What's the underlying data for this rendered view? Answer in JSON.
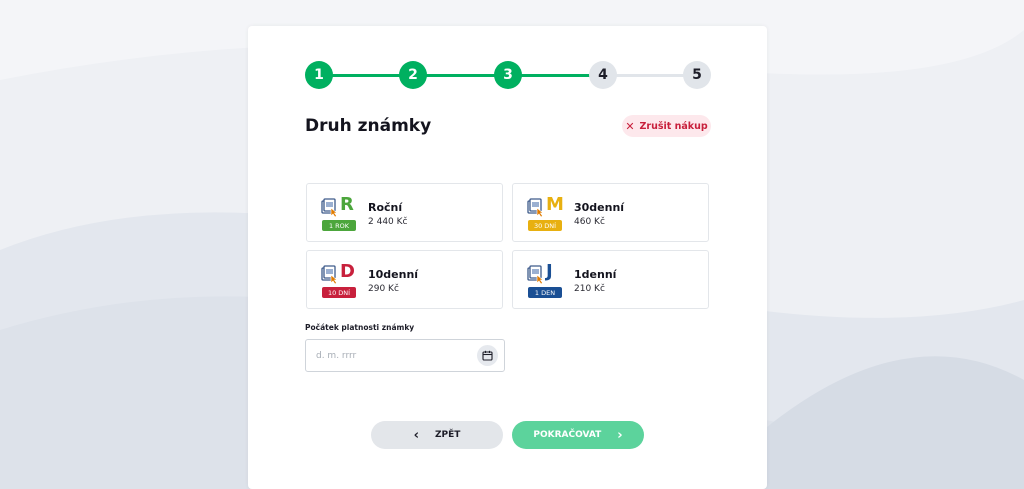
{
  "stepper": {
    "steps": [
      {
        "label": "1",
        "state": "done"
      },
      {
        "label": "2",
        "state": "done"
      },
      {
        "label": "3",
        "state": "done"
      },
      {
        "label": "4",
        "state": "todo"
      },
      {
        "label": "5",
        "state": "todo"
      }
    ],
    "done_color": "#00b060",
    "todo_color": "#e1e5ea"
  },
  "header": {
    "title": "Druh známky",
    "cancel_label": "Zrušit nákup",
    "cancel_icon": "close-icon"
  },
  "options": [
    {
      "name": "Roční",
      "price": "2 440 Kč",
      "letter": "R",
      "badge": "1 ROK",
      "color": "#4ca63c",
      "icon": "vignette-icon"
    },
    {
      "name": "30denní",
      "price": "460 Kč",
      "letter": "M",
      "badge": "30 DNÍ",
      "color": "#e8b010",
      "icon": "vignette-icon"
    },
    {
      "name": "10denní",
      "price": "290 Kč",
      "letter": "D",
      "badge": "10 DNÍ",
      "color": "#c8203c",
      "icon": "vignette-icon"
    },
    {
      "name": "1denní",
      "price": "210 Kč",
      "letter": "J",
      "badge": "1 DEN",
      "color": "#1a4f94",
      "icon": "vignette-icon"
    }
  ],
  "validity": {
    "label": "Počátek platnosti známky",
    "placeholder": "d. m. rrrr",
    "value": "",
    "icon": "calendar-icon"
  },
  "footer": {
    "back_label": "ZPĚT",
    "next_label": "POKRAČOVAT",
    "back_icon": "chevron-left-icon",
    "next_icon": "chevron-right-icon"
  }
}
